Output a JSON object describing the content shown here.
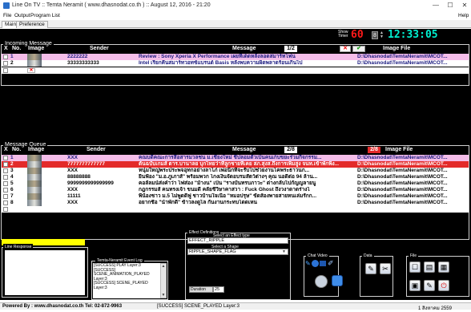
{
  "window": {
    "title": "Line On TV :: Temta Neramit  ( www.dhasnodat.co.th ) :: August 12, 2016 - 21:20",
    "minimize": "—",
    "maximize": "☐",
    "close": "✕"
  },
  "menu": {
    "file": "File",
    "output": "Output",
    "program_list": "Program List",
    "help": "Help"
  },
  "tabs": [
    "Main",
    "Preference"
  ],
  "clock": {
    "show_timer_label_1": "Show",
    "show_timer_label_2": "Timer",
    "timer_value": "60",
    "timer_spin": "8",
    "time": "12:33:05"
  },
  "incoming": {
    "title": "Incoming Message",
    "headers": {
      "x": "X",
      "no": "No.",
      "image": "Image",
      "sender": "Sender",
      "message": "Message",
      "page": "1/2",
      "image_file": "Image File"
    },
    "rows": [
      {
        "no": "1",
        "sender": "2222222",
        "message": "Review : Sony Xperia X Performance เผยที่เด็ดหลังลอดสมาร์ทโฟน",
        "file": "D:\\Dhasnodat\\TemtaNeramit\\MCOT...",
        "style": "pink"
      },
      {
        "no": "2",
        "sender": "33333333333",
        "message": "Intel เรียกคืนสมาร์ทวอทช์แบรนด์ Basis หลังพบความผิดพลาดร้อนเกินไป",
        "file": "D:\\Dhasnodat\\TemtaNeramit\\MCOT...",
        "style": "normal"
      }
    ]
  },
  "queue": {
    "title": "Message Queue",
    "headers": {
      "x": "X",
      "no": "No.",
      "image": "Image",
      "sender": "Sender",
      "message": "Message",
      "page": "2/8",
      "page2": "2/8",
      "image_file": "Image File"
    },
    "rows": [
      {
        "no": "1",
        "sender": "XXX",
        "message": "คณบดีคณะการสื่อสารมวลชน ม.เชียงใหม่ ชี้ปลอมตัวเป็นคนเก็บขยะร่วมกิจกรรม...",
        "file": "D:\\Dhasnodat\\TemtaNeramit\\MCOT...",
        "style": "pink"
      },
      {
        "no": "2",
        "sender": "7777777777777",
        "message": "ต้นฉบับเกมส์ ตาร.บานาลย บุกไทยว่าที่ลูกชายที่เคย สภ.สุงส.ถึงการเพิ่มสูง จนท.เข้าพักพิง...",
        "file": "D:\\Dhasnodat\\TemtaNeramit\\MCOT...",
        "style": "red"
      },
      {
        "no": "3",
        "sender": "XXX",
        "message": "หนุ่มใหญ่พระประพจอุทกอย่างลาโภ่ เพ่อนีกที่จะรับไปช่วยงานโคพระธาวนก...",
        "file": "D:\\Dhasnodat\\TemtaNeramit\\MCOT...",
        "style": "normal"
      },
      {
        "no": "4",
        "sender": "88888888",
        "message": "ยื่นฟ้อง \"ม.อ.ภูเภาส์\" พร้อมพวก โกงเงินจัดอบรมสัตว์ต่างๆ คุณ นอดีต่อ 94 ล้าน...",
        "file": "D:\\Dhasnodat\\TemtaNeramit\\MCOT...",
        "style": "normal"
      },
      {
        "no": "5",
        "sender": "9999999999999999",
        "message": "คอลัลมน์ส่งคำว่า ไฟส่อง \"ม้างน\" เป็น \"รางบันทรบภาวะ\" ต่างกลับไปกัญญลายนู",
        "file": "D:\\Dhasnodat\\TemtaNeramit\\MCOT...",
        "style": "normal"
      },
      {
        "no": "6",
        "sender": "XXX",
        "message": "กฎกรรมส์ คนทรงเจ้า ขนมดี คลัยชีวิษาคาสวา : Fuck Ghost ถึงวงาดาดร่างไ",
        "file": "D:\\Dhasnodat\\TemtaNeramit\\MCOT...",
        "style": "normal"
      },
      {
        "no": "7",
        "sender": "11111",
        "message": "พี่น้องชาว ม.5 ไม่พูดดีฟู ชาวบ้านใจเนื่อ \"หมอปรุษ\" ขัดส์องพายสายหนเล่มรักก...",
        "file": "D:\\Dhasnodat\\TemtaNeramit\\MCOT...",
        "style": "normal"
      },
      {
        "no": "8",
        "sender": "XXX",
        "message": "อยากชื่อ \"น้ำพักดี\" ข้าวลงดูไล กันงานกระทบโดดเหน",
        "file": "D:\\Dhasnodat\\TemtaNeramit\\MCOT...",
        "style": "normal"
      }
    ]
  },
  "bottom": {
    "line_response_label": "Line Response",
    "event_log_label": "Temta-Neramit Event Log",
    "event_log_lines": [
      "[SUCCESS] PLAY Layer:3",
      "[SUCCESS]",
      "SCENE_ANIMATION_PLAYED",
      "Layer:3",
      "[SUCCESS] SCENE_PLAYED",
      "Layer:3"
    ],
    "effect_label": "Effect Definitions",
    "effect_select_label": "Select an Effect type",
    "effect_value": "EFFECT_RIPPLE",
    "shape_select_label": "Select a Shape",
    "shape_value": "RIPPLE_SHAPE_FLAG",
    "duration_label": "Duration",
    "duration_value": "25",
    "chat_video_label": "Chat Video",
    "data_label": "Data",
    "file_label": "File"
  },
  "status": {
    "left": "Powered By : www.dhasnodat.co.th Tel: 02-872-9963",
    "middle": "[SUCCESS]  SCENE_PLAYED Layer:3",
    "right": "1 สิงหาคม 2559"
  },
  "colors": {
    "pink_row": "#f4bde9",
    "red_row": "#e32a2a",
    "clock_red": "#ff1a1a",
    "yellow_bar": "#ffff00"
  }
}
